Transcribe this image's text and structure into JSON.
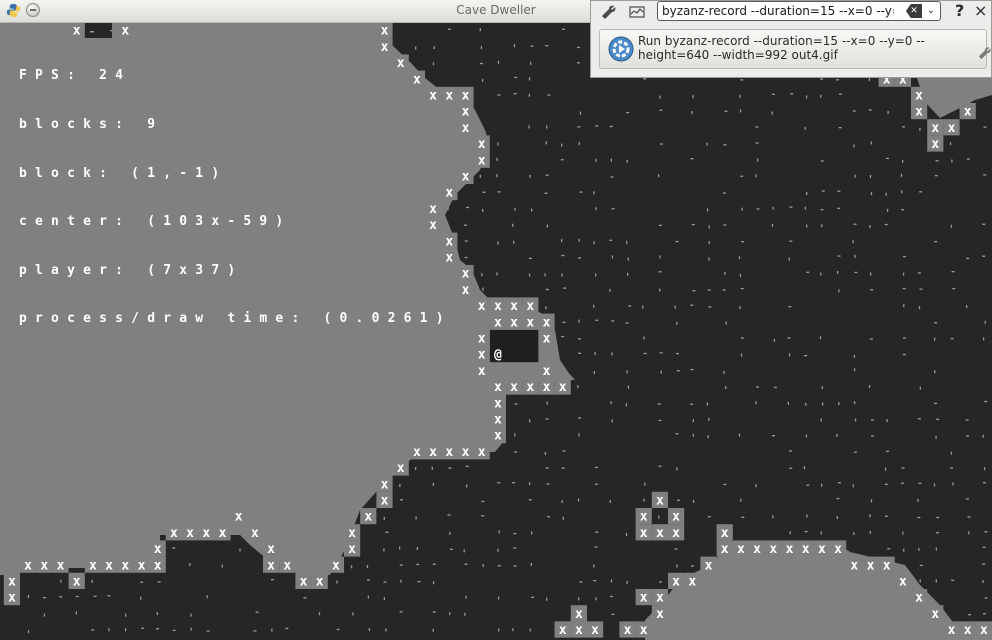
{
  "window": {
    "title": "Cave Dweller"
  },
  "hud": {
    "fps": "FPS: 24",
    "blocks": "blocks: 9",
    "block": "block: (1,-1)",
    "center": "center: (103x-59)",
    "player": "player: (7x37)",
    "process": "process/draw time: (0.0261)"
  },
  "launcher": {
    "command_value": "byzanz-record --duration=15 --x=0 --y=0 --height=640 --width=992 out4.gif",
    "clear_icon": "backspace-clear-icon",
    "dropdown_icon": "chevron-down-icon",
    "help_label": "?",
    "close_label": "×",
    "result_text": "Run byzanz-record --duration=15 --x=0 --y=0 --height=640 --width=992 out4.gif",
    "icons": [
      "wrench-icon",
      "chart-icon",
      "run-icon",
      "python-icon"
    ]
  },
  "game": {
    "player_glyph": "@",
    "wall_glyph": "x",
    "floor_glyph": ".",
    "colors": {
      "open": "#808080",
      "rock": "#262626",
      "speck": "#9a9a9a",
      "wall_bg": "#808080",
      "wall_fg": "#ffffff",
      "player_bg": "#1f1f1f"
    }
  }
}
